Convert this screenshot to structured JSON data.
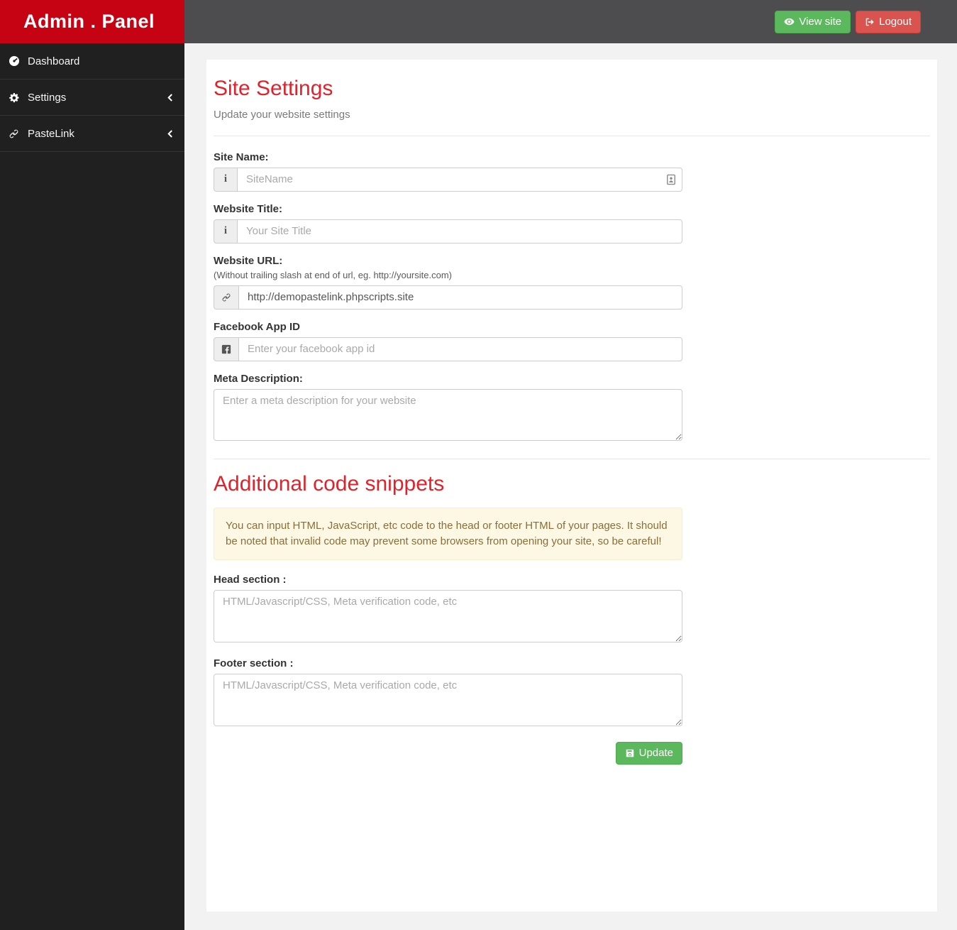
{
  "brand": {
    "title": "Admin . Panel"
  },
  "topbar": {
    "view_site_label": "View site",
    "logout_label": "Logout"
  },
  "sidebar": {
    "items": [
      {
        "label": "Dashboard",
        "icon": "dashboard-icon",
        "has_submenu": false
      },
      {
        "label": "Settings",
        "icon": "gear-icon",
        "has_submenu": true
      },
      {
        "label": "PasteLink",
        "icon": "link-icon",
        "has_submenu": true
      }
    ]
  },
  "page": {
    "title": "Site Settings",
    "subtitle": "Update your website settings",
    "fields": {
      "site_name": {
        "label": "Site Name:",
        "placeholder": "SiteName"
      },
      "website_title": {
        "label": "Website Title:",
        "placeholder": "Your Site Title"
      },
      "website_url": {
        "label": "Website URL:",
        "help": "(Without trailing slash at end of url, eg. http://yoursite.com)",
        "value": "http://demopastelink.phpscripts.site"
      },
      "facebook_app_id": {
        "label": "Facebook App ID",
        "placeholder": "Enter your facebook app id"
      },
      "meta_description": {
        "label": "Meta Description:",
        "placeholder": "Enter a meta description for your website"
      }
    },
    "snippets": {
      "title": "Additional code snippets",
      "warning": "You can input HTML, JavaScript, etc code to the head or footer HTML of your pages. It should be noted that invalid code may prevent some browsers from opening your site, so be careful!",
      "head_label": "Head section :",
      "footer_label": "Footer section :",
      "code_placeholder": "HTML/Javascript/CSS, Meta verification code, etc",
      "update_label": "Update"
    }
  },
  "icons": {
    "info": "i"
  },
  "colors": {
    "brand_red": "#c60312",
    "heading_red": "#e2222a",
    "topbar_gray": "#4d4d4f",
    "sidebar_dark": "#202020",
    "success_green": "#5cb85c",
    "danger_red": "#d9534f",
    "warning_bg": "#fcf8e3",
    "warning_text": "#8a6d3b"
  }
}
